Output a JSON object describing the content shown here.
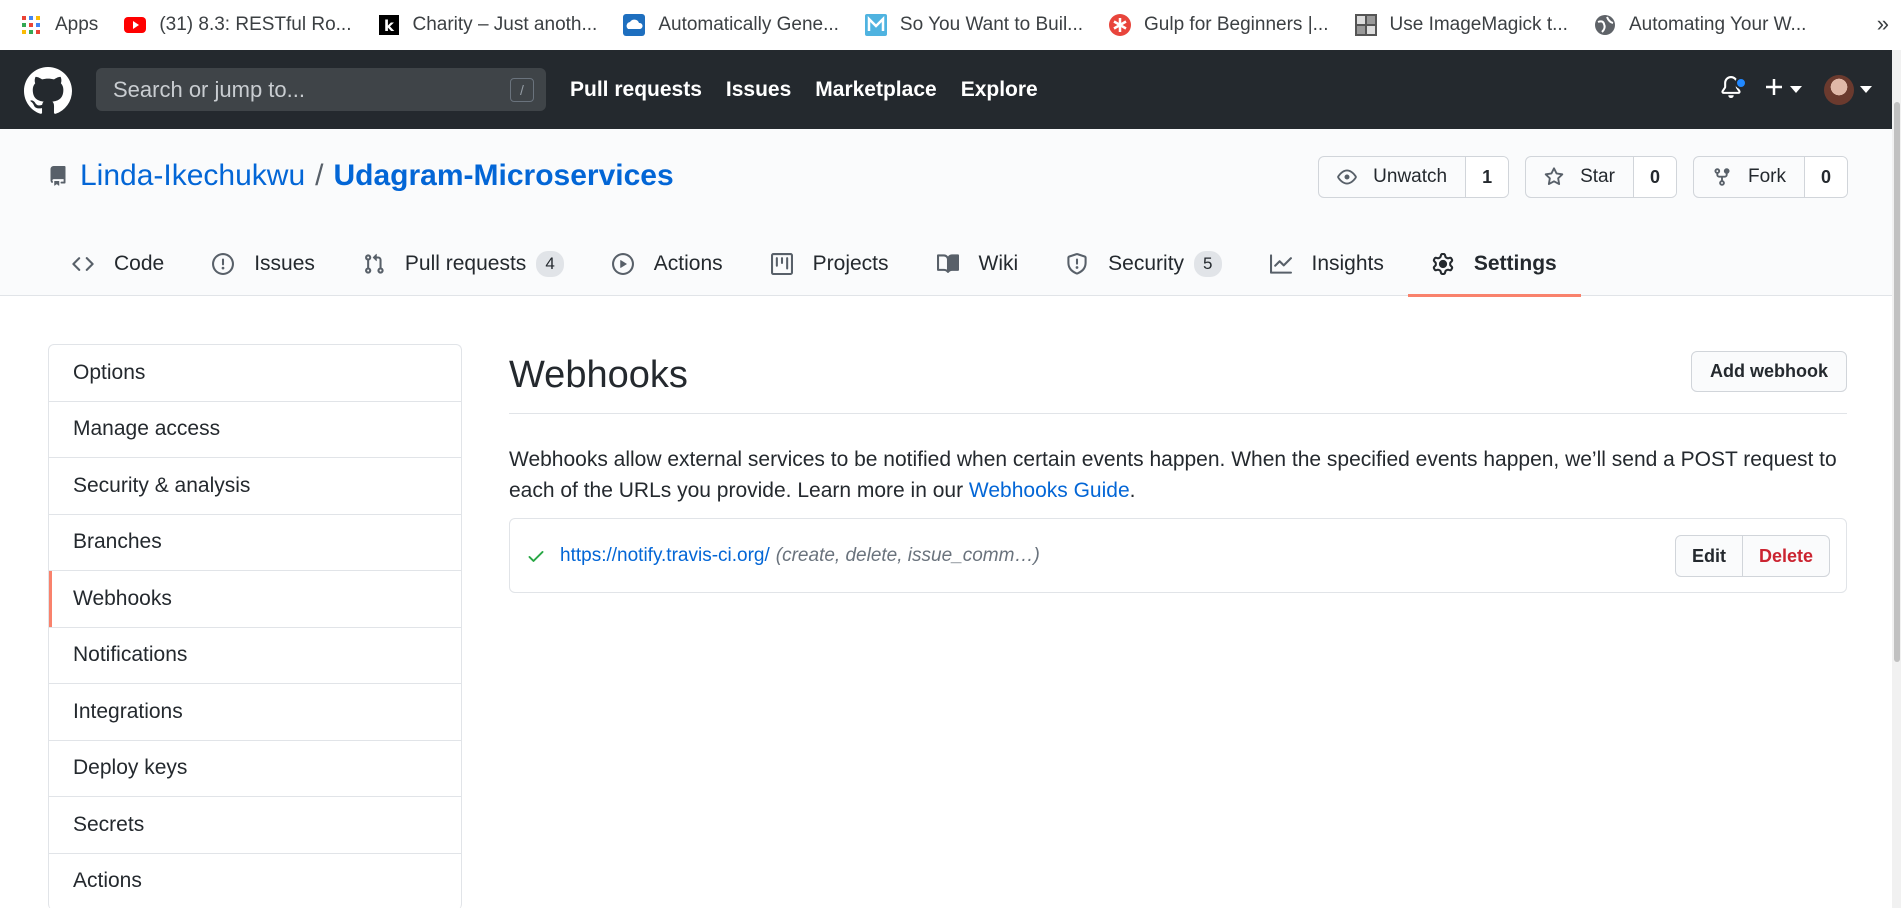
{
  "bookmarks": [
    {
      "label": "Apps",
      "icon": "apps-grid-icon"
    },
    {
      "label": "(31) 8.3: RESTful Ro...",
      "icon": "youtube-icon"
    },
    {
      "label": "Charity – Just anoth...",
      "icon": "k-logo-icon"
    },
    {
      "label": "Automatically Gene...",
      "icon": "cloud-icon"
    },
    {
      "label": "So You Want to Buil...",
      "icon": "m-logo-icon"
    },
    {
      "label": "Gulp for Beginners |...",
      "icon": "asterisk-logo-icon"
    },
    {
      "label": "Use ImageMagick t...",
      "icon": "imagemagick-icon"
    },
    {
      "label": "Automating Your W...",
      "icon": "globe-icon"
    }
  ],
  "bookmarks_more": "»",
  "header": {
    "search_placeholder": "Search or jump to...",
    "search_shortcut": "/",
    "nav": [
      "Pull requests",
      "Issues",
      "Marketplace",
      "Explore"
    ]
  },
  "repo": {
    "owner": "Linda-Ikechukwu",
    "separator": "/",
    "name": "Udagram-Microservices",
    "actions": {
      "watch_label": "Unwatch",
      "watch_count": "1",
      "star_label": "Star",
      "star_count": "0",
      "fork_label": "Fork",
      "fork_count": "0"
    },
    "tabs": [
      {
        "label": "Code",
        "counter": ""
      },
      {
        "label": "Issues",
        "counter": ""
      },
      {
        "label": "Pull requests",
        "counter": "4"
      },
      {
        "label": "Actions",
        "counter": ""
      },
      {
        "label": "Projects",
        "counter": ""
      },
      {
        "label": "Wiki",
        "counter": ""
      },
      {
        "label": "Security",
        "counter": "5"
      },
      {
        "label": "Insights",
        "counter": ""
      },
      {
        "label": "Settings",
        "counter": ""
      }
    ],
    "selected_tab": "Settings"
  },
  "settings_menu": [
    "Options",
    "Manage access",
    "Security & analysis",
    "Branches",
    "Webhooks",
    "Notifications",
    "Integrations",
    "Deploy keys",
    "Secrets",
    "Actions"
  ],
  "settings_selected": "Webhooks",
  "webhooks": {
    "title": "Webhooks",
    "add_button": "Add webhook",
    "description_text": "Webhooks allow external services to be notified when certain events happen. When the specified events happen, we’ll send a POST request to each of the URLs you provide. Learn more in our ",
    "guide_link": "Webhooks Guide",
    "description_end": ".",
    "hooks": [
      {
        "url": "https://notify.travis-ci.org/",
        "events": "(create, delete, issue_comm…)",
        "status": "success"
      }
    ],
    "edit_label": "Edit",
    "delete_label": "Delete"
  },
  "colors": {
    "header_bg": "#24292e",
    "link": "#0366d6",
    "selected_accent": "#f9826c",
    "danger": "#cb2431",
    "success": "#28a745"
  }
}
